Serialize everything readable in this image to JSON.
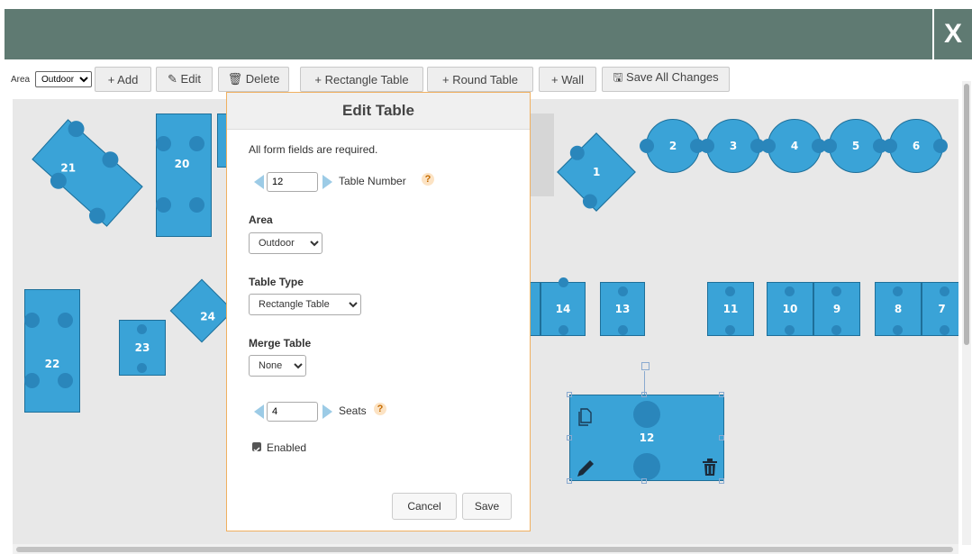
{
  "close_label": "X",
  "toolbar": {
    "area_label": "Area",
    "area_value": "Outdoor",
    "add": "+ Add",
    "edit": "✎ Edit",
    "delete": "🗑 Delete",
    "rect_table": "+ Rectangle Table",
    "round_table": "+ Round Table",
    "wall": "+ Wall",
    "save_all": "🖫 Save All Changes"
  },
  "tables": {
    "t1": "1",
    "t2": "2",
    "t3": "3",
    "t4": "4",
    "t5": "5",
    "t6": "6",
    "t7": "7",
    "t8": "8",
    "t9": "9",
    "t10": "10",
    "t11": "11",
    "t12": "12",
    "t13": "13",
    "t14": "14",
    "t20": "20",
    "t21": "21",
    "t22": "22",
    "t23": "23",
    "t24": "24"
  },
  "modal": {
    "title": "Edit Table",
    "required_note": "All form fields are required.",
    "table_number_value": "12",
    "table_number_label": "Table Number",
    "help": "?",
    "area_label": "Area",
    "area_value": "Outdoor",
    "table_type_label": "Table Type",
    "table_type_value": "Rectangle Table",
    "merge_label": "Merge Table",
    "merge_value": "None",
    "seats_value": "4",
    "seats_label": "Seats",
    "enabled_label": "Enabled",
    "cancel": "Cancel",
    "save": "Save"
  },
  "colors": {
    "header": "#5f7a72",
    "table": "#3aa3d7",
    "seat": "#2a86bb",
    "accent": "#f0b060"
  }
}
